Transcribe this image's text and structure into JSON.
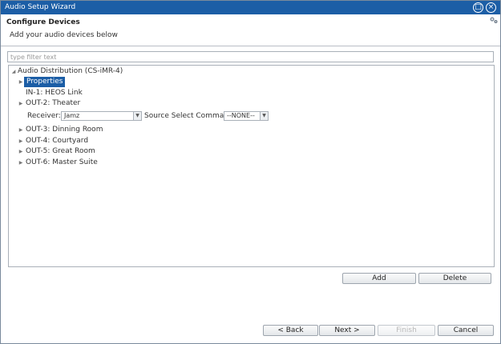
{
  "window": {
    "title": "Audio Setup Wizard"
  },
  "header": {
    "title": "Configure Devices",
    "subtitle": "Add your audio devices below"
  },
  "filter": {
    "placeholder": "type filter text",
    "value": ""
  },
  "tree": {
    "root": "Audio Distribution (CS-iMR-4)",
    "properties": "Properties",
    "input": "IN-1: HEOS Link",
    "outputs": [
      "OUT-2: Theater",
      "OUT-3: Dinning Room",
      "OUT-4: Courtyard",
      "OUT-5: Great Room",
      "OUT-6: Master Suite"
    ],
    "receiver_label": "Receiver:",
    "receiver_value": "Jamz",
    "source_cmd_label": "Source Select Command:",
    "source_cmd_value": "--NONE--"
  },
  "actions": {
    "add": "Add",
    "delete": "Delete"
  },
  "footer": {
    "back": "< Back",
    "next": "Next >",
    "finish": "Finish",
    "cancel": "Cancel"
  }
}
